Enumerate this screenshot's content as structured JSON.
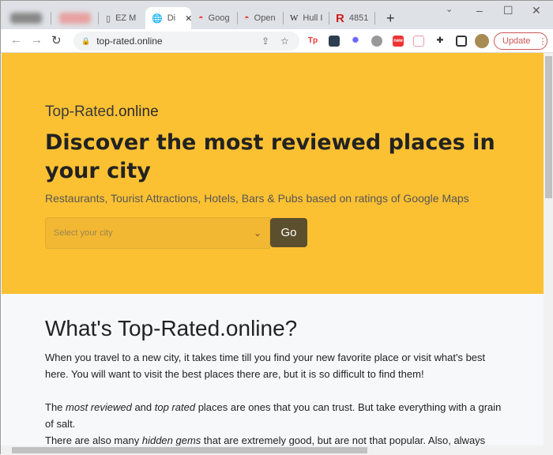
{
  "browser": {
    "tabs": [
      {
        "label": ""
      },
      {
        "label": ""
      },
      {
        "label": "EZ M"
      },
      {
        "label": "Di"
      },
      {
        "label": "Goog"
      },
      {
        "label": "Open"
      },
      {
        "label": "Hull I"
      },
      {
        "label": "4851"
      }
    ],
    "new_tab": "+",
    "url": "top-rated.online",
    "update_label": "Update",
    "extensions": [
      "Tp",
      "",
      "",
      "",
      "new",
      "",
      "",
      ""
    ]
  },
  "hero": {
    "brand_light": "Top-Rated",
    "brand_bold": ".online",
    "title": "Discover the most reviewed places in your city",
    "subtitle": "Restaurants, Tourist Attractions, Hotels, Bars & Pubs based on ratings of Google Maps",
    "select_placeholder": "Select your city",
    "go_label": "Go"
  },
  "about": {
    "title": "What's Top-Rated.online?",
    "p1": "When you travel to a new city, it takes time till you find your new favorite place or visit what's best here. You will want to visit the best places there are, but it is so difficult to find them!",
    "p2_a": "The ",
    "p2_em1": "most reviewed",
    "p2_b": " and ",
    "p2_em2": "top rated",
    "p2_c": " places are ones that you can trust. But take everything with a grain of salt.",
    "p3_a": "There are also many ",
    "p3_em": "hidden gems",
    "p3_b": " that are extremely good, but are not that popular. Also, always"
  }
}
